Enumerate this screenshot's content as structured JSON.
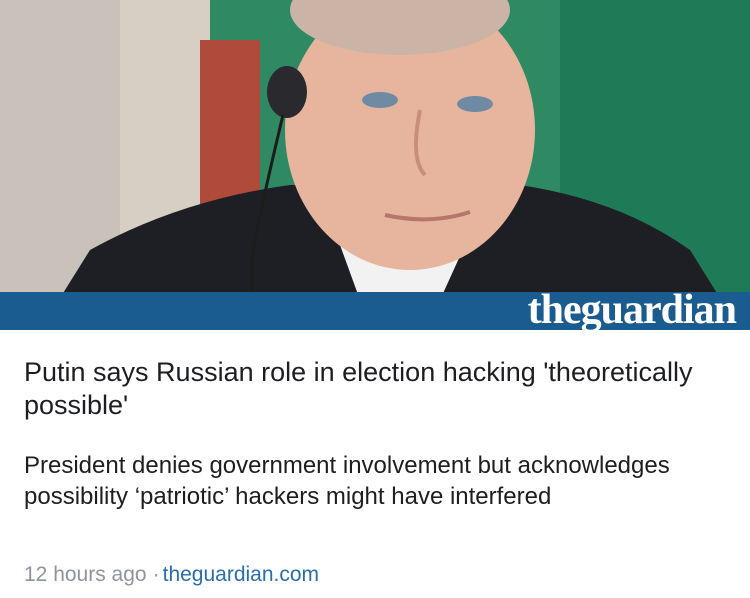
{
  "article": {
    "image_alt": "Putin wearing an earpiece",
    "brand": "theguardian",
    "headline": "Putin says Russian role in election hacking 'theoretically possible'",
    "summary": "President denies government involvement but acknowledges possibility ‘patriotic’ hackers might have interfered",
    "time": "12 hours ago",
    "separator": "·",
    "source": "theguardian.com"
  },
  "colors": {
    "brand_blue": "#1a5c8f",
    "background_green": "#2f8a63",
    "link_blue": "#2b6cb0",
    "meta_gray": "#8d949e"
  }
}
